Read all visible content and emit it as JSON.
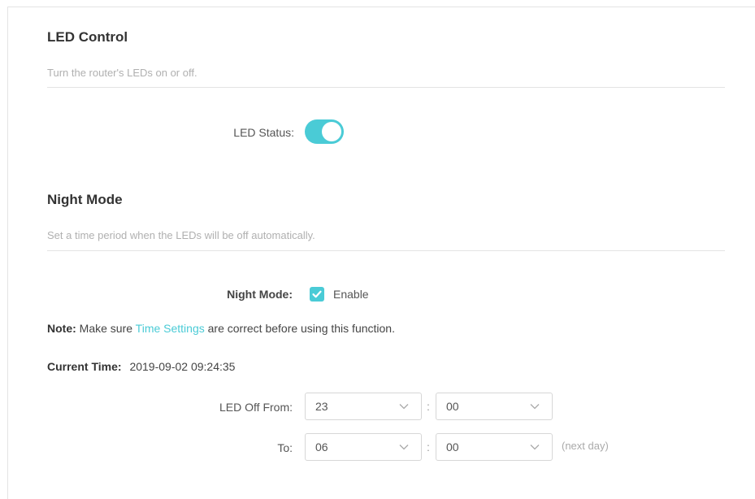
{
  "led_control": {
    "title": "LED Control",
    "description": "Turn the router's LEDs on or off.",
    "status_label": "LED Status:",
    "status_on": true
  },
  "night_mode": {
    "title": "Night Mode",
    "description": "Set a time period when the LEDs will be off automatically.",
    "label": "Night Mode:",
    "enable_label": "Enable",
    "enabled": true,
    "note_prefix": "Note:",
    "note_before_link": " Make sure ",
    "note_link": "Time Settings",
    "note_after_link": " are correct before using this function.",
    "current_time_label": "Current Time:",
    "current_time_value": "2019-09-02 09:24:35",
    "off_from_label": "LED Off From:",
    "off_from_hour": "23",
    "off_from_minute": "00",
    "to_label": "To:",
    "to_hour": "06",
    "to_minute": "00",
    "colon": ":",
    "next_day": "(next day)"
  },
  "colors": {
    "accent": "#4acbd6"
  },
  "icons": {
    "select_chevron": "chevron-down-icon",
    "checkbox_mark": "check-icon"
  }
}
